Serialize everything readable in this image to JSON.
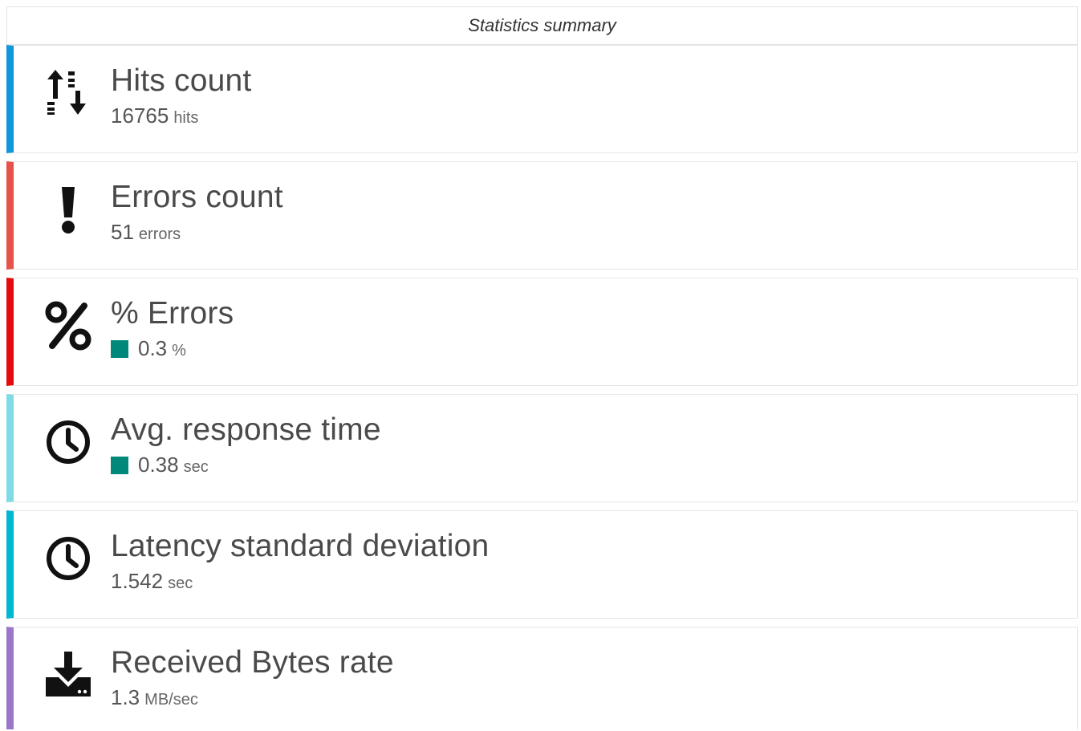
{
  "header": {
    "title": "Statistics summary"
  },
  "cards": [
    {
      "title": "Hits count",
      "value": "16765",
      "unit": "hits",
      "accent": "#1296db",
      "icon": "sort-arrows-icon",
      "swatch": null
    },
    {
      "title": "Errors count",
      "value": "51",
      "unit": "errors",
      "accent": "#e5534b",
      "icon": "exclamation-icon",
      "swatch": null
    },
    {
      "title": "% Errors",
      "value": "0.3",
      "unit": "%",
      "accent": "#e30b0b",
      "icon": "percent-icon",
      "swatch": "#00897b"
    },
    {
      "title": "Avg. response time",
      "value": "0.38",
      "unit": "sec",
      "accent": "#7fdbe6",
      "icon": "clock-icon",
      "swatch": "#00897b"
    },
    {
      "title": "Latency standard deviation",
      "value": "1.542",
      "unit": "sec",
      "accent": "#00b7d0",
      "icon": "clock-icon",
      "swatch": null
    },
    {
      "title": "Received Bytes rate",
      "value": "1.3",
      "unit": "MB/sec",
      "accent": "#9b77cc",
      "icon": "download-icon",
      "swatch": null
    }
  ]
}
